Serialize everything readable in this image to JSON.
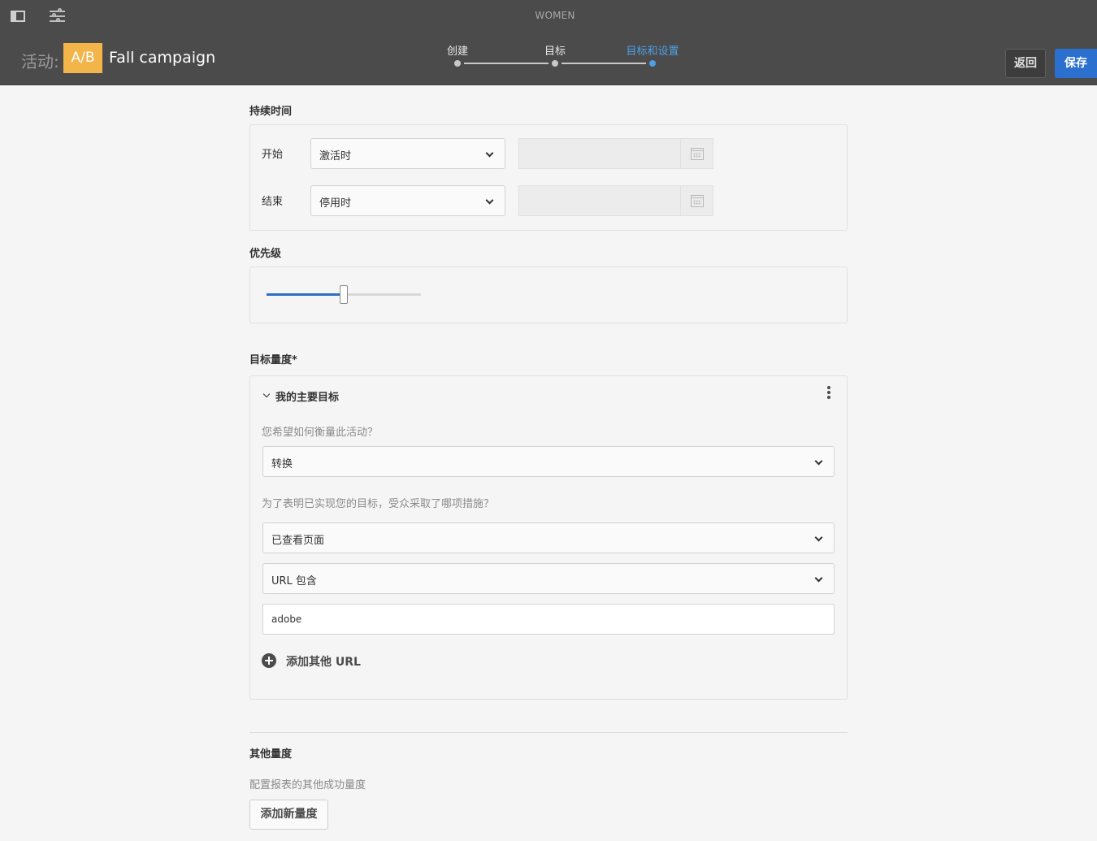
{
  "header": {
    "site_title": "WOMEN",
    "activity_label": "活动:",
    "activity_type": "A/B",
    "activity_name": "Fall campaign",
    "steps": [
      {
        "label": "创建",
        "active": false
      },
      {
        "label": "目标",
        "active": false
      },
      {
        "label": "目标和设置",
        "active": true
      }
    ],
    "back_label": "返回",
    "save_label": "保存",
    "accent_color": "#4f9fe6",
    "save_color": "#2b6fcf",
    "badge_color": "#f3b44a"
  },
  "duration": {
    "title": "持续时间",
    "start_label": "开始",
    "start_value": "激活时",
    "start_date": "",
    "end_label": "结束",
    "end_value": "停用时",
    "end_date": ""
  },
  "priority": {
    "title": "优先级",
    "value_fraction": 0.5
  },
  "goal_metric": {
    "title": "目标量度*",
    "goal_name": "我的主要目标",
    "question_measure": "您希望如何衡量此活动？",
    "measure_value": "转换",
    "question_action": "为了表明已实现您的目标，受众采取了哪项措施？",
    "action_value": "已查看页面",
    "url_condition": "URL 包含",
    "url_value": "adobe",
    "add_url_label": "添加其他 URL"
  },
  "other_metrics": {
    "title": "其他量度",
    "description": "配置报表的其他成功量度",
    "add_button": "添加新量度"
  }
}
